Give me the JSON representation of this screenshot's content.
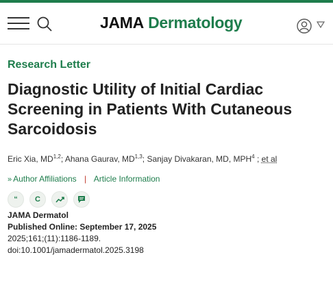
{
  "header": {
    "brand_part1": "JAMA",
    "brand_part2": "Dermatology"
  },
  "article": {
    "type": "Research Letter",
    "title": "Diagnostic Utility of Initial Cardiac Screening in Patients With Cutaneous Sarcoidosis",
    "authors": [
      {
        "name": "Eric Xia, MD",
        "sup": "1,2"
      },
      {
        "name": "Ahana Gaurav, MD",
        "sup": "1,3"
      },
      {
        "name": "Sanjay Divakaran, MD, MPH",
        "sup": "4"
      }
    ],
    "et_al": "et al",
    "links": {
      "affiliations": "Author Affiliations",
      "separator": "|",
      "info": "Article Information"
    },
    "action_icons": {
      "cite": "“",
      "permissions": "C"
    },
    "journal": "JAMA Dermatol",
    "published": "Published Online: September 17, 2025",
    "citation": "2025;161;(11):1186-1189.",
    "doi": "doi:10.1001/jamadermatol.2025.3198"
  },
  "colors": {
    "accent": "#1e7d4c",
    "separator": "#c0392b"
  }
}
